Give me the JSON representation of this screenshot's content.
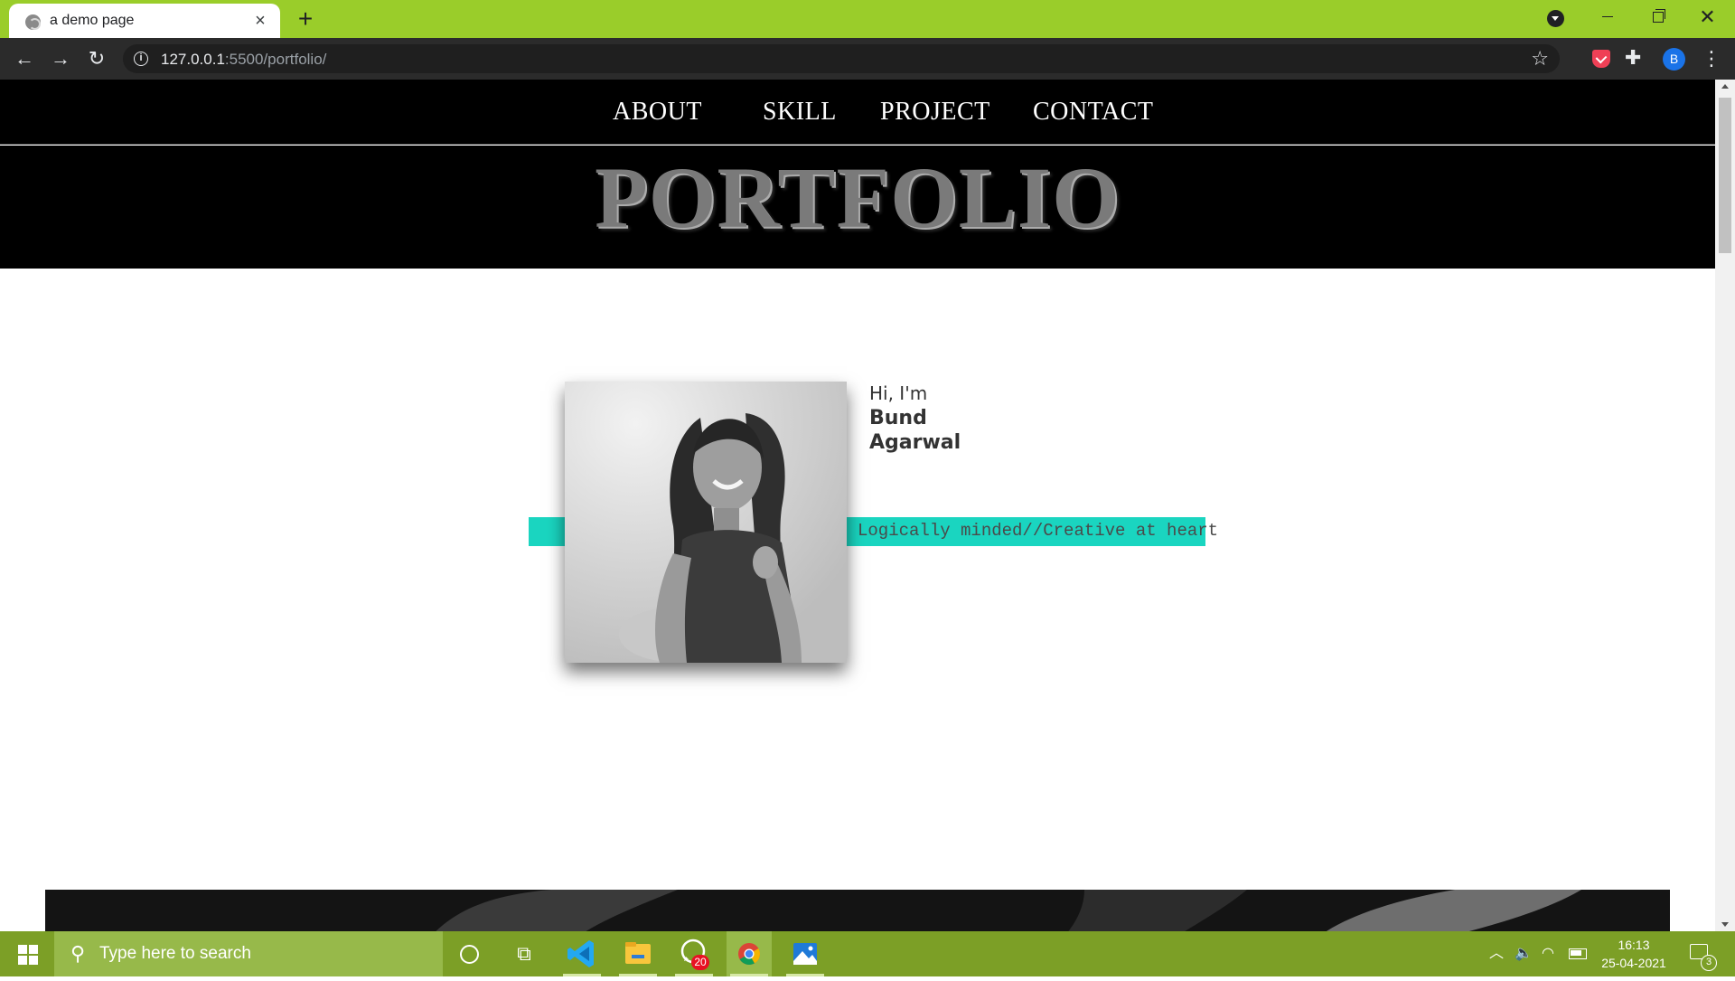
{
  "browser": {
    "tab_title": "a demo page",
    "tab_close_label": "×",
    "new_tab_label": "+",
    "url_host": "127.0.0.1",
    "url_path": ":5500/portfolio/",
    "profile_initial": "B",
    "icons": [
      "globe-icon",
      "close-icon",
      "plus-icon",
      "profile-dropdown-icon",
      "minimize-icon",
      "restore-icon",
      "window-close-icon",
      "back-arrow-icon",
      "forward-arrow-icon",
      "reload-icon",
      "info-icon",
      "bookmark-star-icon",
      "pocket-extension-icon",
      "extensions-puzzle-icon",
      "more-menu-icon"
    ]
  },
  "site": {
    "nav": {
      "about": "ABOUT",
      "skill": "SKILL",
      "project": "PROJECT",
      "contact": "CONTACT"
    },
    "hero_title": "PORTFOLIO",
    "intro": {
      "greeting": "Hi, I'm",
      "first_name": "Bund",
      "last_name": "Agarwal",
      "tagline": "Logically minded//Creative at heart"
    },
    "accent_color": "#1ad5c0"
  },
  "taskbar": {
    "search_placeholder": "Type here to search",
    "whatsapp_badge": "20",
    "time": "16:13",
    "date": "25-04-2021",
    "notification_count": "3",
    "apps": [
      "vscode-icon",
      "file-explorer-icon",
      "whatsapp-icon",
      "chrome-icon",
      "photos-icon"
    ],
    "color": "#7c9f26"
  }
}
